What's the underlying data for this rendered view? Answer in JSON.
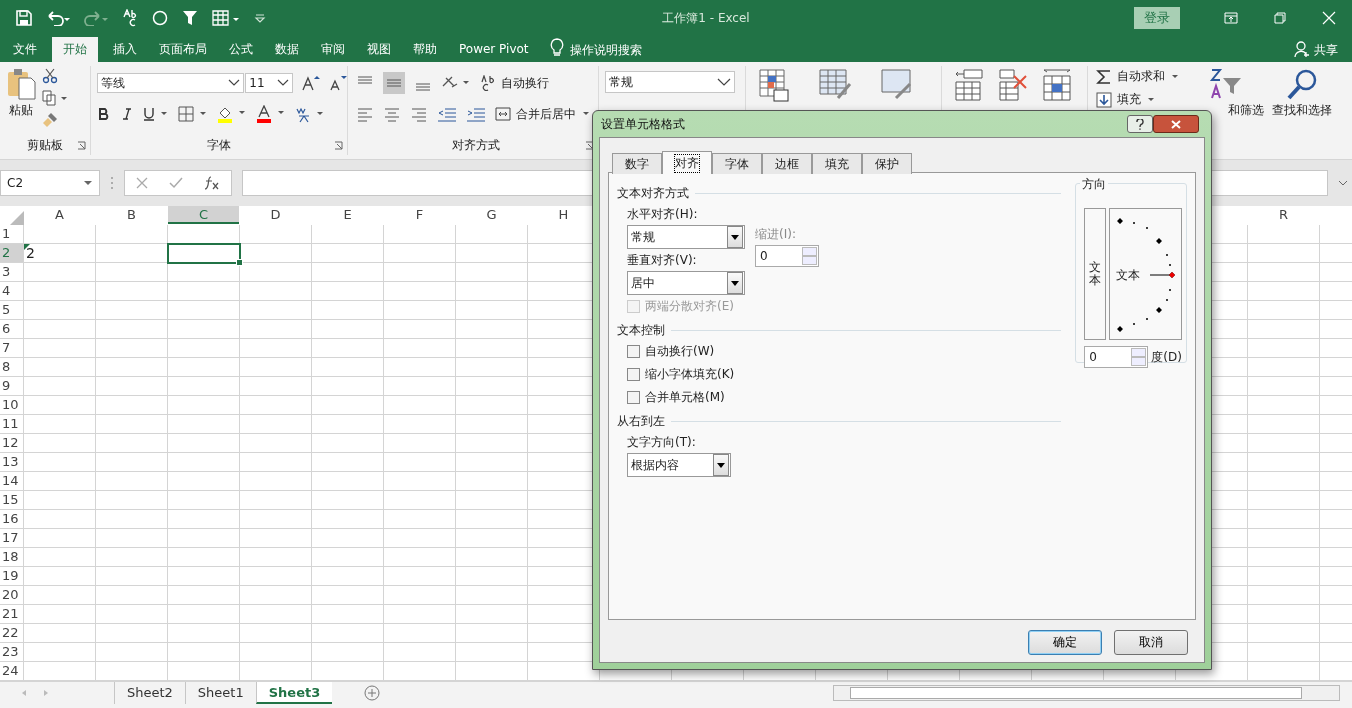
{
  "title_bar": {
    "title": "工作簿1  -  Excel",
    "login": "登录"
  },
  "menu_tabs": [
    {
      "label": "文件",
      "selected": false
    },
    {
      "label": "开始",
      "selected": true
    },
    {
      "label": "插入",
      "selected": false
    },
    {
      "label": "页面布局",
      "selected": false
    },
    {
      "label": "公式",
      "selected": false
    },
    {
      "label": "数据",
      "selected": false
    },
    {
      "label": "审阅",
      "selected": false
    },
    {
      "label": "视图",
      "selected": false
    },
    {
      "label": "帮助",
      "selected": false
    },
    {
      "label": "Power Pivot",
      "selected": false
    }
  ],
  "tell_me": "操作说明搜索",
  "share": "共享",
  "ribbon": {
    "clipboard": {
      "paste": "粘贴",
      "label": "剪贴板"
    },
    "font": {
      "name": "等线",
      "size": "11",
      "label": "字体"
    },
    "alignment": {
      "wrap_text": "自动换行",
      "merge": "合并后居中",
      "label": "对齐方式"
    },
    "number": {
      "format": "常规"
    },
    "editing": {
      "autosum": "自动求和",
      "fill": "填充",
      "sort_filter": "和筛选",
      "find_select": "查找和选择"
    }
  },
  "formula_bar": {
    "name_box": "C2"
  },
  "grid": {
    "columns": [
      {
        "label": "A",
        "selected": false
      },
      {
        "label": "B",
        "selected": false
      },
      {
        "label": "C",
        "selected": true
      },
      {
        "label": "D",
        "selected": false
      },
      {
        "label": "E",
        "selected": false
      },
      {
        "label": "F",
        "selected": false
      },
      {
        "label": "G",
        "selected": false
      },
      {
        "label": "H",
        "selected": false
      }
    ],
    "right_columns": [
      {
        "label": "R",
        "selected": false
      }
    ],
    "rows": [
      {
        "label": "1",
        "selected": false
      },
      {
        "label": "2",
        "selected": true,
        "cells": [
          {
            "value": "2",
            "error_flag": true,
            "active": false
          },
          {
            "active": false
          },
          {
            "active": true
          }
        ]
      },
      {
        "label": "3",
        "selected": false
      },
      {
        "label": "4",
        "selected": false
      },
      {
        "label": "5",
        "selected": false
      },
      {
        "label": "6",
        "selected": false
      },
      {
        "label": "7",
        "selected": false
      },
      {
        "label": "8",
        "selected": false
      },
      {
        "label": "9",
        "selected": false
      },
      {
        "label": "10",
        "selected": false
      },
      {
        "label": "11",
        "selected": false
      },
      {
        "label": "12",
        "selected": false
      },
      {
        "label": "13",
        "selected": false
      },
      {
        "label": "14",
        "selected": false
      },
      {
        "label": "15",
        "selected": false
      },
      {
        "label": "16",
        "selected": false
      },
      {
        "label": "17",
        "selected": false
      },
      {
        "label": "18",
        "selected": false
      },
      {
        "label": "19",
        "selected": false
      },
      {
        "label": "20",
        "selected": false
      },
      {
        "label": "21",
        "selected": false
      },
      {
        "label": "22",
        "selected": false
      },
      {
        "label": "23",
        "selected": false
      },
      {
        "label": "24",
        "selected": false
      }
    ]
  },
  "sheet_tabs": [
    {
      "label": "Sheet2",
      "selected": false
    },
    {
      "label": "Sheet1",
      "selected": false
    },
    {
      "label": "Sheet3",
      "selected": true
    }
  ],
  "dialog": {
    "title": "设置单元格格式",
    "tabs": [
      {
        "label": "数字",
        "selected": false
      },
      {
        "label": "对齐",
        "selected": true
      },
      {
        "label": "字体",
        "selected": false
      },
      {
        "label": "边框",
        "selected": false
      },
      {
        "label": "填充",
        "selected": false
      },
      {
        "label": "保护",
        "selected": false
      }
    ],
    "text_alignment": {
      "heading": "文本对齐方式",
      "horizontal": {
        "label": "水平对齐(H):",
        "value": "常规"
      },
      "indent": {
        "label": "缩进(I):",
        "value": "0",
        "disabled": true
      },
      "vertical": {
        "label": "垂直对齐(V):",
        "value": "居中"
      },
      "distributed": {
        "label": "两端分散对齐(E)",
        "checked": false,
        "disabled": true
      }
    },
    "text_control": {
      "heading": "文本控制",
      "options": [
        {
          "label": "自动换行(W)",
          "checked": false,
          "disabled": false
        },
        {
          "label": "缩小字体填充(K)",
          "checked": false,
          "disabled": false
        },
        {
          "label": "合并单元格(M)",
          "checked": false,
          "disabled": false
        }
      ]
    },
    "right_to_left": {
      "heading": "从右到左",
      "direction": {
        "label": "文字方向(T):",
        "value": "根据内容"
      }
    },
    "orientation": {
      "heading": "方向",
      "vertical_text": "文本",
      "dial_text": "文本",
      "degrees": "0",
      "unit": "度(D)"
    },
    "buttons": [
      {
        "label": "确定",
        "default": true
      },
      {
        "label": "取消",
        "default": false
      }
    ]
  }
}
